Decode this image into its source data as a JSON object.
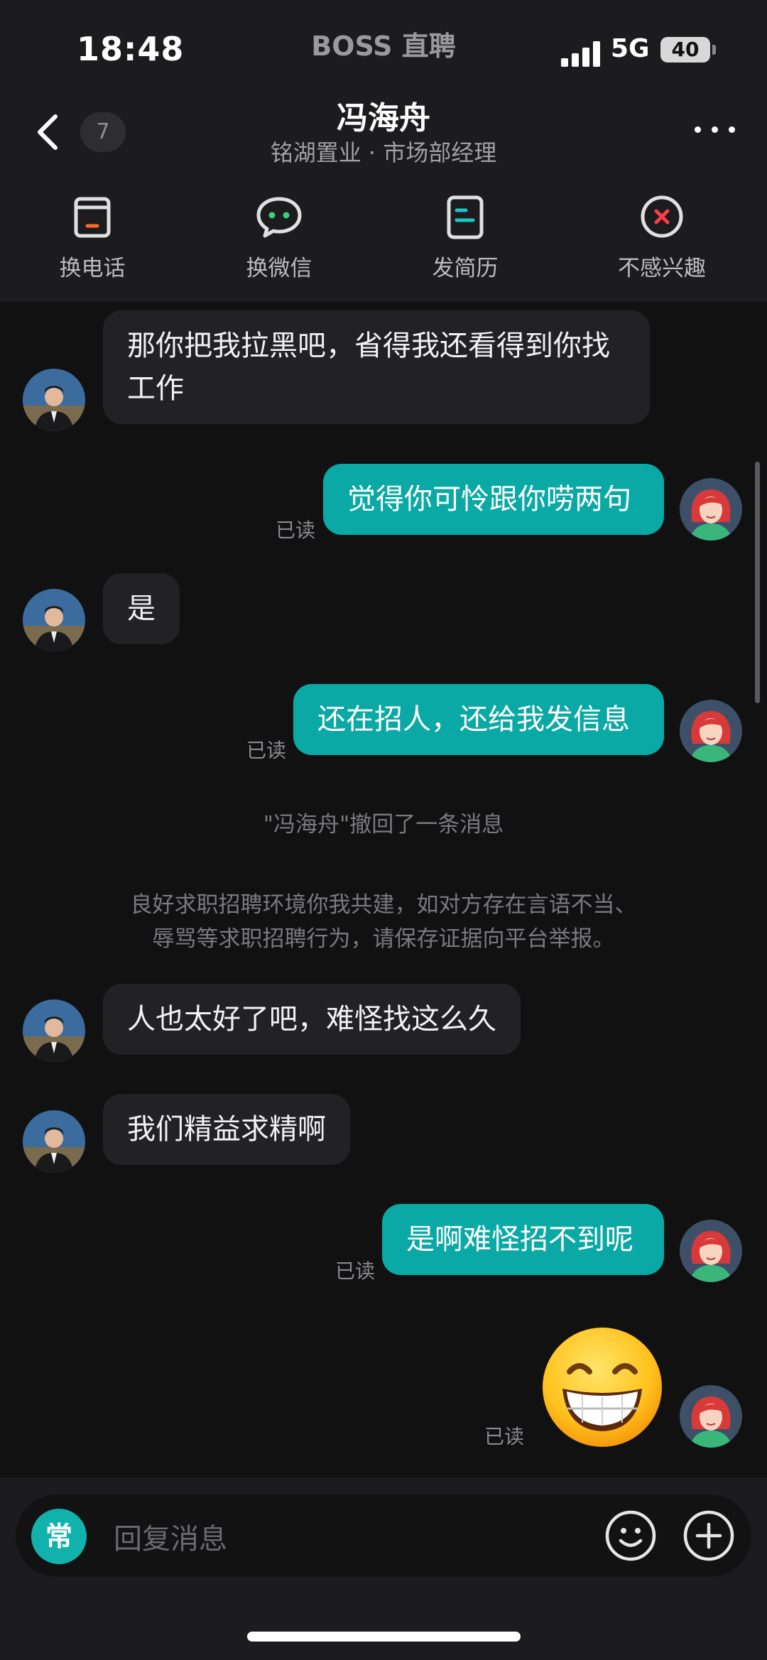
{
  "status_bar": {
    "time": "18:48",
    "carrier": "BOSS 直聘",
    "network": "5G",
    "battery": "40"
  },
  "header": {
    "unread_count": "7",
    "title": "冯海舟",
    "subtitle": "铭湖置业 · 市场部经理"
  },
  "actions": [
    {
      "label": "换电话",
      "icon": "phone-swap-icon"
    },
    {
      "label": "换微信",
      "icon": "wechat-icon"
    },
    {
      "label": "发简历",
      "icon": "resume-icon"
    },
    {
      "label": "不感兴趣",
      "icon": "not-interested-icon"
    }
  ],
  "messages": [
    {
      "side": "in",
      "text": "那你把我拉黑吧，省得我还看得到你找工作"
    },
    {
      "side": "out",
      "text": "觉得你可怜跟你唠两句",
      "status": "已读"
    },
    {
      "side": "in",
      "text": "是"
    },
    {
      "side": "out",
      "text": "还在招人，还给我发信息",
      "status": "已读"
    },
    {
      "side": "in",
      "text": "人也太好了吧，难怪找这么久"
    },
    {
      "side": "in",
      "text": "我们精益求精啊"
    },
    {
      "side": "out",
      "text": "是啊难怪招不到呢",
      "status": "已读"
    },
    {
      "side": "out",
      "emoji": "grinning-face",
      "status": "已读"
    }
  ],
  "system": {
    "recall": "\"冯海舟\"撤回了一条消息",
    "notice_line1": "良好求职招聘环境你我共建，如对方存在言语不当、",
    "notice_line2": "辱骂等求职招聘行为，请保存证据向平台举报。"
  },
  "input": {
    "chang_label": "常",
    "placeholder": "回复消息"
  },
  "colors": {
    "accent": "#0aa9a5",
    "background": "#111112",
    "bar": "#1c1c1e",
    "incoming_bubble": "#222225"
  }
}
